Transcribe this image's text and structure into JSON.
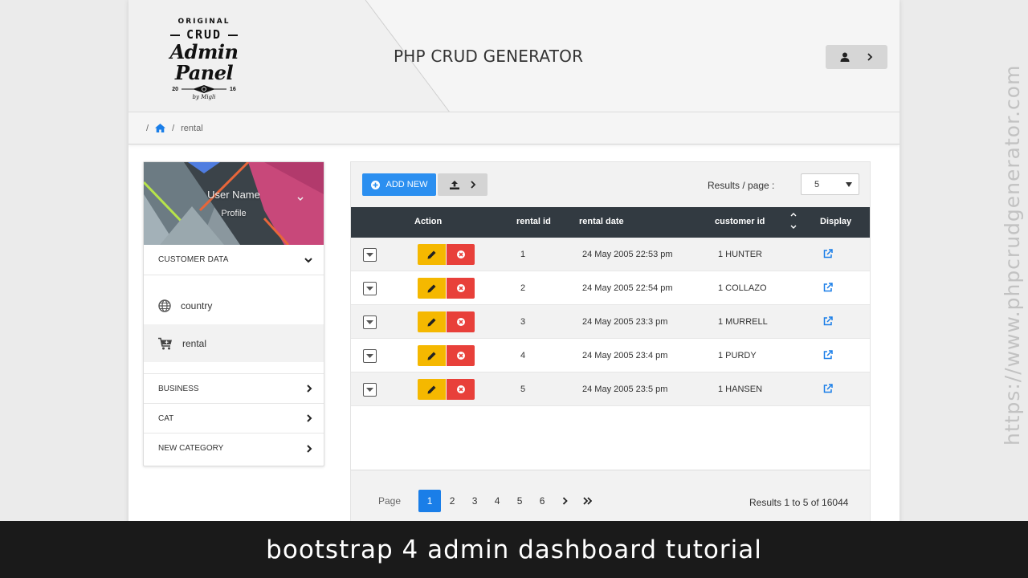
{
  "header": {
    "logo": {
      "line1": "ORIGINAL",
      "line2": "CRUD",
      "line3": "Admin Panel",
      "year_left": "20",
      "year_right": "16",
      "byline": "by Migli"
    },
    "title": "PHP CRUD GENERATOR",
    "user_icon": "user-icon",
    "user_chevron": "chevron-right-icon"
  },
  "breadcrumb": {
    "sep": "/",
    "home_icon": "home-icon",
    "current": "rental"
  },
  "sidebar": {
    "profile": {
      "name": "User Name",
      "link": "Profile"
    },
    "sections": [
      {
        "label": "CUSTOMER DATA",
        "expanded": true
      },
      {
        "label": "BUSINESS",
        "expanded": false
      },
      {
        "label": "CAT",
        "expanded": false
      },
      {
        "label": "NEW CATEGORY",
        "expanded": false
      }
    ],
    "customer_items": [
      {
        "label": "country",
        "icon": "globe-icon",
        "active": false
      },
      {
        "label": "rental",
        "icon": "cart-icon",
        "active": true
      }
    ]
  },
  "toolbar": {
    "add_label": "ADD NEW",
    "add_icon": "plus-circle-icon",
    "export_icon": "upload-icon",
    "results_per_page_label": "Results / page :",
    "results_per_page_value": "5"
  },
  "table": {
    "columns": [
      "Action",
      "rental id",
      "rental date",
      "customer id",
      "Display"
    ],
    "rows": [
      {
        "rental_id": "1",
        "rental_date": "24 May 2005 22:53 pm",
        "customer_id": "1 HUNTER"
      },
      {
        "rental_id": "2",
        "rental_date": "24 May 2005 22:54 pm",
        "customer_id": "1 COLLAZO"
      },
      {
        "rental_id": "3",
        "rental_date": "24 May 2005 23:3 pm",
        "customer_id": "1 MURRELL"
      },
      {
        "rental_id": "4",
        "rental_date": "24 May 2005 23:4 pm",
        "customer_id": "1 PURDY"
      },
      {
        "rental_id": "5",
        "rental_date": "24 May 2005 23:5 pm",
        "customer_id": "1 HANSEN"
      }
    ]
  },
  "pagination": {
    "label": "Page",
    "pages": [
      "1",
      "2",
      "3",
      "4",
      "5",
      "6"
    ],
    "current": "1",
    "next": "›",
    "last": "»",
    "results_text": "Results 1 to 5 of 16044"
  },
  "watermark": "https://www.phpcrudgenerator.com",
  "banner": "bootstrap 4 admin dashboard tutorial",
  "colors": {
    "primary": "#2b8ff0",
    "edit": "#f5b800",
    "delete": "#e8403a",
    "table_header": "#323a41",
    "link": "#1a7ee8"
  }
}
